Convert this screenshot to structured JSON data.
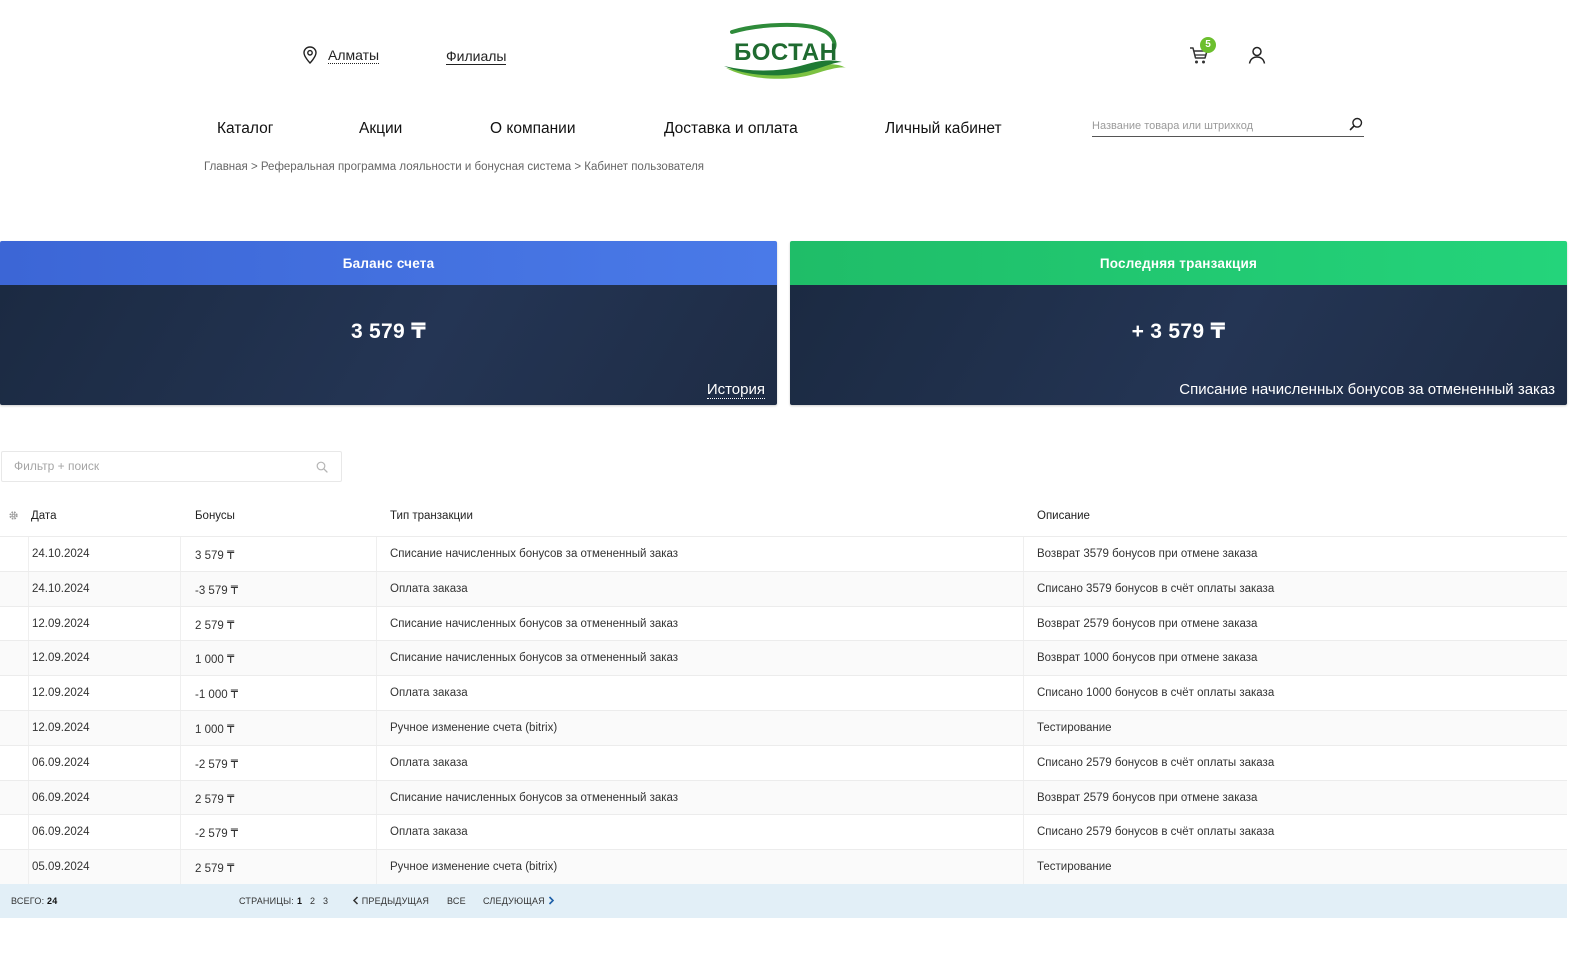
{
  "header": {
    "city": "Алматы",
    "branches": "Филиалы",
    "logo_text": "БОСТАН",
    "cart_count": "5",
    "colors": {
      "brand_green": "#1f7a34",
      "badge_green": "#6cbf2e"
    }
  },
  "nav": {
    "items": [
      {
        "label": "Каталог"
      },
      {
        "label": "Акции"
      },
      {
        "label": "О компании"
      },
      {
        "label": "Доставка и оплата"
      },
      {
        "label": "Личный кабинет"
      }
    ],
    "search_placeholder": "Название товара или штрихкод"
  },
  "breadcrumb": "Главная > Реферальная программа лояльности и бонусная система > Кабинет пользователя",
  "balance_card": {
    "title": "Баланс счета",
    "amount": "3 579 ₸",
    "history_link": "История",
    "color": "#4472e0"
  },
  "last_card": {
    "title": "Последняя транзакция",
    "amount": "+ 3 579 ₸",
    "description": "Списание начисленных бонусов за отмененный заказ",
    "color": "#22c870"
  },
  "filter": {
    "placeholder": "Фильтр + поиск"
  },
  "table": {
    "columns": {
      "date": "Дата",
      "bonus": "Бонусы",
      "type": "Тип транзакции",
      "description": "Описание"
    },
    "rows": [
      {
        "date": "24.10.2024",
        "bonus": "3 579 ₸",
        "type": "Списание начисленных бонусов за отмененный заказ",
        "description": "Возврат 3579 бонусов при отмене заказа"
      },
      {
        "date": "24.10.2024",
        "bonus": "-3 579 ₸",
        "type": "Оплата заказа",
        "description": "Списано 3579 бонусов в счёт оплаты заказа"
      },
      {
        "date": "12.09.2024",
        "bonus": "2 579 ₸",
        "type": "Списание начисленных бонусов за отмененный заказ",
        "description": "Возврат 2579 бонусов при отмене заказа"
      },
      {
        "date": "12.09.2024",
        "bonus": "1 000 ₸",
        "type": "Списание начисленных бонусов за отмененный заказ",
        "description": "Возврат 1000 бонусов при отмене заказа"
      },
      {
        "date": "12.09.2024",
        "bonus": "-1 000 ₸",
        "type": "Оплата заказа",
        "description": "Списано 1000 бонусов в счёт оплаты заказа"
      },
      {
        "date": "12.09.2024",
        "bonus": "1 000 ₸",
        "type": "Ручное изменение счета (bitrix)",
        "description": "Тестирование"
      },
      {
        "date": "06.09.2024",
        "bonus": "-2 579 ₸",
        "type": "Оплата заказа",
        "description": "Списано 2579 бонусов в счёт оплаты заказа"
      },
      {
        "date": "06.09.2024",
        "bonus": "2 579 ₸",
        "type": "Списание начисленных бонусов за отмененный заказ",
        "description": "Возврат 2579 бонусов при отмене заказа"
      },
      {
        "date": "06.09.2024",
        "bonus": "-2 579 ₸",
        "type": "Оплата заказа",
        "description": "Списано 2579 бонусов в счёт оплаты заказа"
      },
      {
        "date": "05.09.2024",
        "bonus": "2 579 ₸",
        "type": "Ручное изменение счета (bitrix)",
        "description": "Тестирование"
      }
    ]
  },
  "pager": {
    "total_label": "Всего:",
    "total": "24",
    "pages_label": "Страницы:",
    "pages": [
      "1",
      "2",
      "3"
    ],
    "prev": "Предыдущая",
    "all": "Все",
    "next": "Следующая"
  }
}
